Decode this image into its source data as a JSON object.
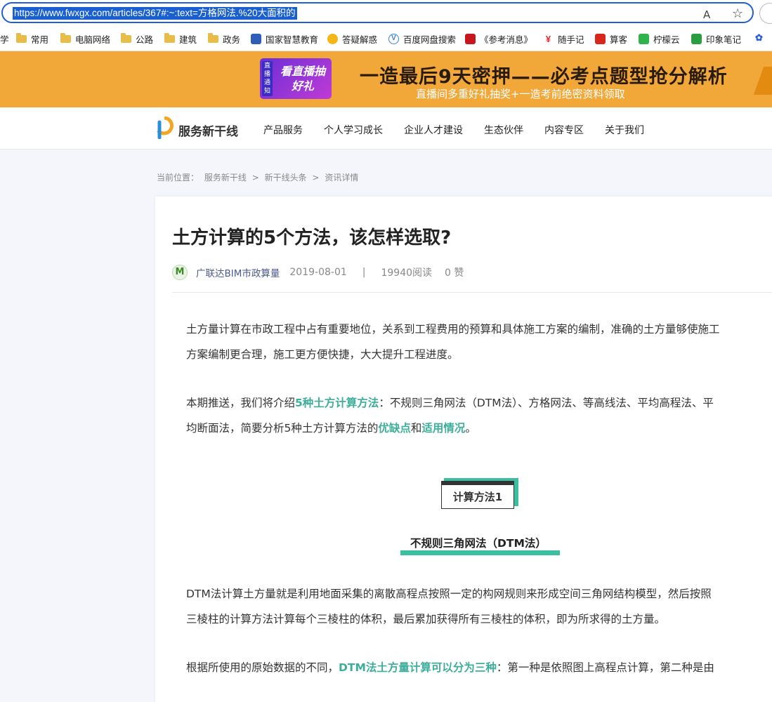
{
  "browser": {
    "url": "https://www.fwxgx.com/articles/367#:~:text=方格网法.%20大面积的",
    "read_aloud_icon": "A",
    "favorite_icon": "☆"
  },
  "bookmarks": [
    {
      "label": "学",
      "type": "text"
    },
    {
      "label": "常用",
      "type": "folder"
    },
    {
      "label": "电脑网络",
      "type": "folder"
    },
    {
      "label": "公路",
      "type": "folder"
    },
    {
      "label": "建筑",
      "type": "folder"
    },
    {
      "label": "政务",
      "type": "folder"
    },
    {
      "label": "国家智慧教育",
      "type": "site"
    },
    {
      "label": "答疑解惑",
      "type": "site"
    },
    {
      "label": "百度网盘搜索",
      "type": "site"
    },
    {
      "label": "《参考消息》",
      "type": "site"
    },
    {
      "label": "随手记",
      "type": "site"
    },
    {
      "label": "算客",
      "type": "site"
    },
    {
      "label": "柠檬云",
      "type": "site"
    },
    {
      "label": "印象笔记",
      "type": "site"
    }
  ],
  "banner": {
    "badge_tag": "直播通知",
    "badge_text": "看直播抽好礼",
    "title": "一造最后9天密押——必考点题型抢分解析",
    "subtitle": "直播间多重好礼抽奖+一造考前绝密资料领取"
  },
  "nav": {
    "logo_text": "服务新干线",
    "items": [
      "产品服务",
      "个人学习成长",
      "企业人才建设",
      "生态伙伴",
      "内容专区",
      "关于我们"
    ]
  },
  "breadcrumb": {
    "label": "当前位置：",
    "crumbs": [
      "服务新干线",
      "新干线头条",
      "资讯详情"
    ],
    "separator": ">"
  },
  "article": {
    "title": "土方计算的5个方法，该怎样选取?",
    "author_initial": "M",
    "author": "广联达BIM市政算量",
    "date": "2019-08-01",
    "divider": "|",
    "reads": "19940阅读",
    "likes": "0 赞",
    "p1_line1": "土方量计算在市政工程中占有重要地位，关系到工程费用的预算和具体施工方案的编制，准确的土方量够使施工",
    "p1_line2": "方案编制更合理，施工更方便快捷，大大提升工程进度。",
    "p2_line1_a": "本期推送，我们将介绍",
    "p2_line1_hl": "5种土方计算方法",
    "p2_line1_b": "：不规则三角网法（DTM法）、方格网法、等高线法、平均高程法、平",
    "p2_line2_a": "均断面法，简要分析5种土方计算方法的",
    "p2_line2_hl1": "优缺点",
    "p2_line2_mid": "和",
    "p2_line2_hl2": "适用情况",
    "p2_line2_end": "。",
    "method_label": "计算方法1",
    "method_name": "不规则三角网法（DTM法）",
    "p3_line1": "DTM法计算土方量就是利用地面采集的离散高程点按照一定的构网规则来形成空间三角网结构模型，然后按照",
    "p3_line2": "三棱柱的计算方法计算每个三棱柱的体积，最后累加获得所有三棱柱的体积，即为所求得的土方量。",
    "p4_a": "根据所使用的原始数据的不同，",
    "p4_hl": "DTM法土方量计算可以分为三种",
    "p4_b": "：第一种是依照图上高程点计算，第二种是由"
  },
  "colors": {
    "accent": "#3bbfa0",
    "highlight_text": "#3dae9a",
    "banner_bg": "#f2a839",
    "url_selection": "#1a5fd0"
  }
}
